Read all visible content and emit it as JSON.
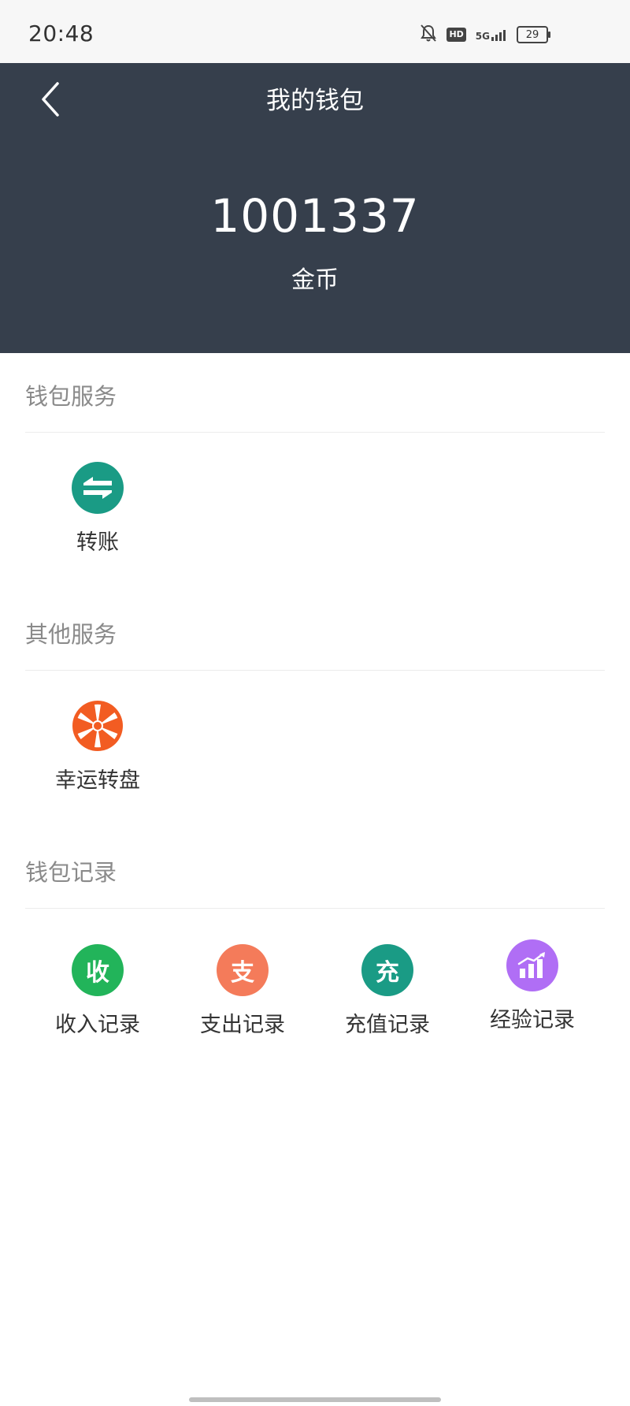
{
  "status_bar": {
    "time": "20:48",
    "hd_label": "HD",
    "network_label": "5G",
    "battery_level": "29"
  },
  "header": {
    "title": "我的钱包",
    "balance": "1001337",
    "unit": "金币",
    "background_color": "#363f4c"
  },
  "sections": {
    "wallet_services": {
      "title": "钱包服务",
      "items": [
        {
          "label": "转账",
          "icon": "transfer-icon",
          "color": "#1a9b85"
        }
      ]
    },
    "other_services": {
      "title": "其他服务",
      "items": [
        {
          "label": "幸运转盘",
          "icon": "lucky-wheel-icon",
          "color": "#f25c22"
        }
      ]
    },
    "wallet_records": {
      "title": "钱包记录",
      "items": [
        {
          "label": "收入记录",
          "icon_text": "收",
          "icon": "income-icon",
          "color": "#22b45a"
        },
        {
          "label": "支出记录",
          "icon_text": "支",
          "icon": "expense-icon",
          "color": "#f47b5a"
        },
        {
          "label": "充值记录",
          "icon_text": "充",
          "icon": "recharge-icon",
          "color": "#1a9b85"
        },
        {
          "label": "经验记录",
          "icon": "experience-chart-icon",
          "color": "#b06ef5"
        }
      ]
    }
  }
}
